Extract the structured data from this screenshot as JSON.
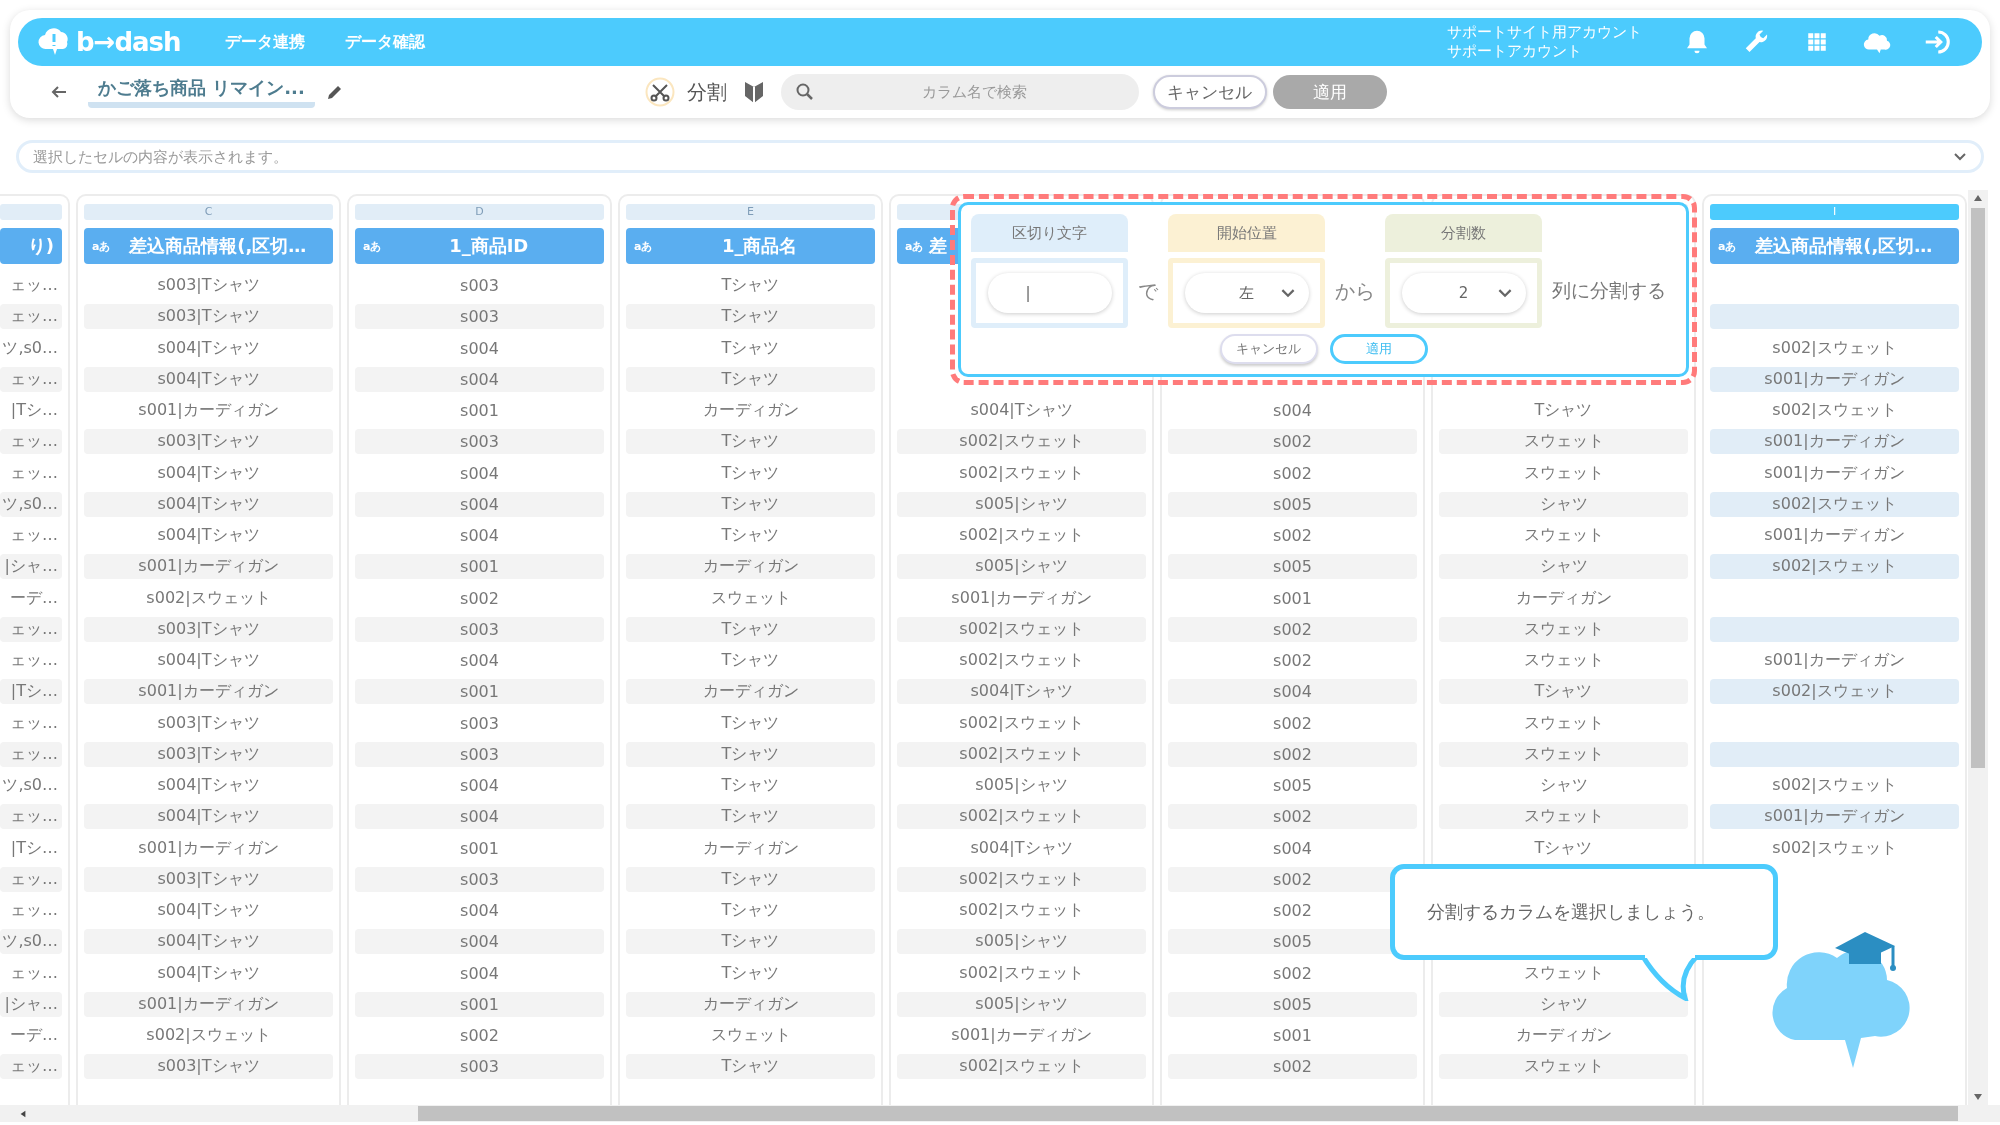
{
  "header": {
    "logo_text": "b→dash",
    "nav": [
      "データ連携",
      "データ確認"
    ],
    "account": [
      "サポートサイト用アカウント",
      "サポートアカウント"
    ]
  },
  "toolbar": {
    "title": "かご落ち商品 リマイン...",
    "mode_label": "分割",
    "search": {
      "placeholder": "カラム名で検索"
    },
    "buttons": [
      {
        "label": "キャンセル",
        "disabled": false
      },
      {
        "label": "適用",
        "disabled": true
      }
    ]
  },
  "cell_viewer": {
    "placeholder": "選択したセルの内容が表示されます。"
  },
  "columns": [
    {
      "kind": "partial",
      "name": "り)",
      "selected": false,
      "cells": [
        "ェッ…",
        "ェッ…",
        "ツ,s0…",
        "ェッ…",
        "|Tシ…",
        "ェッ…",
        "ェッ…",
        "ツ,s0…",
        "ェッ…",
        "|シャ…",
        "ーデ…",
        "ェッ…",
        "ェッ…",
        "|Tシ…",
        "ェッ…",
        "ェッ…",
        "ツ,s0…",
        "ェッ…",
        "|Tシ…",
        "ェッ…",
        "ェッ…",
        "ツ,s0…",
        "ェッ…",
        "|シャ…",
        "ーデ…",
        "ェッ…"
      ]
    },
    {
      "kind": "full",
      "letter": "C",
      "type_label": "aあ",
      "name": "差込商品情報(,区切…",
      "selected": false,
      "cells": [
        "s003|Tシャツ",
        "s003|Tシャツ",
        "s004|Tシャツ",
        "s004|Tシャツ",
        "s001|カーディガン",
        "s003|Tシャツ",
        "s004|Tシャツ",
        "s004|Tシャツ",
        "s004|Tシャツ",
        "s001|カーディガン",
        "s002|スウェット",
        "s003|Tシャツ",
        "s004|Tシャツ",
        "s001|カーディガン",
        "s003|Tシャツ",
        "s003|Tシャツ",
        "s004|Tシャツ",
        "s004|Tシャツ",
        "s001|カーディガン",
        "s003|Tシャツ",
        "s004|Tシャツ",
        "s004|Tシャツ",
        "s004|Tシャツ",
        "s001|カーディガン",
        "s002|スウェット",
        "s003|Tシャツ"
      ]
    },
    {
      "kind": "full",
      "letter": "D",
      "type_label": "aあ",
      "name": "1_商品ID",
      "selected": false,
      "cells": [
        "s003",
        "s003",
        "s004",
        "s004",
        "s001",
        "s003",
        "s004",
        "s004",
        "s004",
        "s001",
        "s002",
        "s003",
        "s004",
        "s001",
        "s003",
        "s003",
        "s004",
        "s004",
        "s001",
        "s003",
        "s004",
        "s004",
        "s004",
        "s001",
        "s002",
        "s003"
      ]
    },
    {
      "kind": "full",
      "letter": "E",
      "type_label": "aあ",
      "name": "1_商品名",
      "selected": false,
      "cells": [
        "Tシャツ",
        "Tシャツ",
        "Tシャツ",
        "Tシャツ",
        "カーディガン",
        "Tシャツ",
        "Tシャツ",
        "Tシャツ",
        "Tシャツ",
        "カーディガン",
        "スウェット",
        "Tシャツ",
        "Tシャツ",
        "カーディガン",
        "Tシャツ",
        "Tシャツ",
        "Tシャツ",
        "Tシャツ",
        "カーディガン",
        "Tシャツ",
        "Tシャツ",
        "Tシャツ",
        "Tシャツ",
        "カーディガン",
        "スウェット",
        "Tシャツ"
      ]
    },
    {
      "kind": "covered",
      "type_label": "aあ",
      "name": "差",
      "selected": false,
      "cells": [
        null,
        null,
        null,
        null,
        "s004|Tシャツ",
        "s002|スウェット",
        "s002|スウェット",
        "s005|シャツ",
        "s002|スウェット",
        "s005|シャツ",
        "s001|カーディガン",
        "s002|スウェット",
        "s002|スウェット",
        "s004|Tシャツ",
        "s002|スウェット",
        "s002|スウェット",
        "s005|シャツ",
        "s002|スウェット",
        "s004|Tシャツ",
        "s002|スウェット",
        "s002|スウェット",
        "s005|シャツ",
        "s002|スウェット",
        "s005|シャツ",
        "s001|カーディガン",
        "s002|スウェット"
      ]
    },
    {
      "kind": "covered",
      "cells": [
        null,
        null,
        null,
        null,
        "s004",
        "s002",
        "s002",
        "s005",
        "s002",
        "s005",
        "s001",
        "s002",
        "s002",
        "s004",
        "s002",
        "s002",
        "s005",
        "s002",
        "s004",
        "s002",
        "s002",
        "s005",
        "s002",
        "s005",
        "s001",
        "s002"
      ]
    },
    {
      "kind": "covered",
      "cells": [
        null,
        null,
        null,
        null,
        "Tシャツ",
        "スウェット",
        "スウェット",
        "シャツ",
        "スウェット",
        "シャツ",
        "カーディガン",
        "スウェット",
        "スウェット",
        "Tシャツ",
        "スウェット",
        "スウェット",
        "シャツ",
        "スウェット",
        "Tシャツ",
        null,
        null,
        null,
        "スウェット",
        "シャツ",
        "カーディガン",
        "スウェット"
      ]
    },
    {
      "kind": "full",
      "letter": "I",
      "type_label": "aあ",
      "name": "差込商品情報(,区切…",
      "selected": true,
      "cells": [
        null,
        null,
        "s002|スウェット",
        "s001|カーディガン",
        "s002|スウェット",
        "s001|カーディガン",
        "s001|カーディガン",
        "s002|スウェット",
        "s001|カーディガン",
        "s002|スウェット",
        null,
        null,
        "s001|カーディガン",
        "s002|スウェット",
        null,
        null,
        "s002|スウェット",
        "s001|カーディガン",
        "s002|スウェット"
      ]
    }
  ],
  "split_popup": {
    "groups": [
      {
        "label": "区切り文字",
        "kind": "input",
        "value": "|",
        "color": "#dfeefa"
      },
      {
        "label": "開始位置",
        "kind": "select",
        "value": "左",
        "color": "#fcf1d3"
      },
      {
        "label": "分割数",
        "kind": "select",
        "value": "2",
        "color": "#edf0dc"
      }
    ],
    "connectors": [
      "で",
      "から"
    ],
    "suffix": "列に分割する",
    "buttons": [
      {
        "label": "キャンセル",
        "primary": false
      },
      {
        "label": "適用",
        "primary": true
      }
    ]
  },
  "hint_bubble": {
    "text": "分割するカラムを選択しましょう。"
  }
}
